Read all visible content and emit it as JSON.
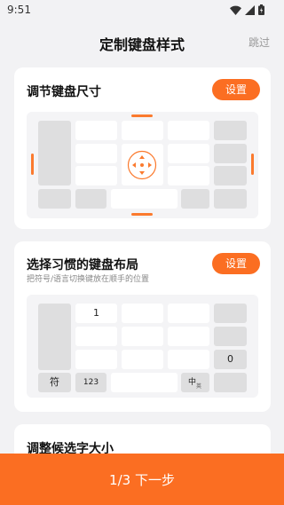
{
  "status": {
    "time": "9:51"
  },
  "header": {
    "title": "定制键盘样式",
    "skip_label": "跳过"
  },
  "card_size": {
    "title": "调节键盘尺寸",
    "button_label": "设置"
  },
  "card_layout": {
    "title": "选择习惯的键盘布局",
    "subtitle": "把符号/语言切换键放在顺手的位置",
    "button_label": "设置",
    "keys": {
      "one": "1",
      "zero": "0",
      "symbol": "符",
      "num": "123",
      "lang_main": "中",
      "lang_sub": "英"
    }
  },
  "card_candidate": {
    "title": "调整候选字大小"
  },
  "footer": {
    "next_label": "1/3 下一步"
  },
  "colors": {
    "accent": "#fb6e22"
  }
}
